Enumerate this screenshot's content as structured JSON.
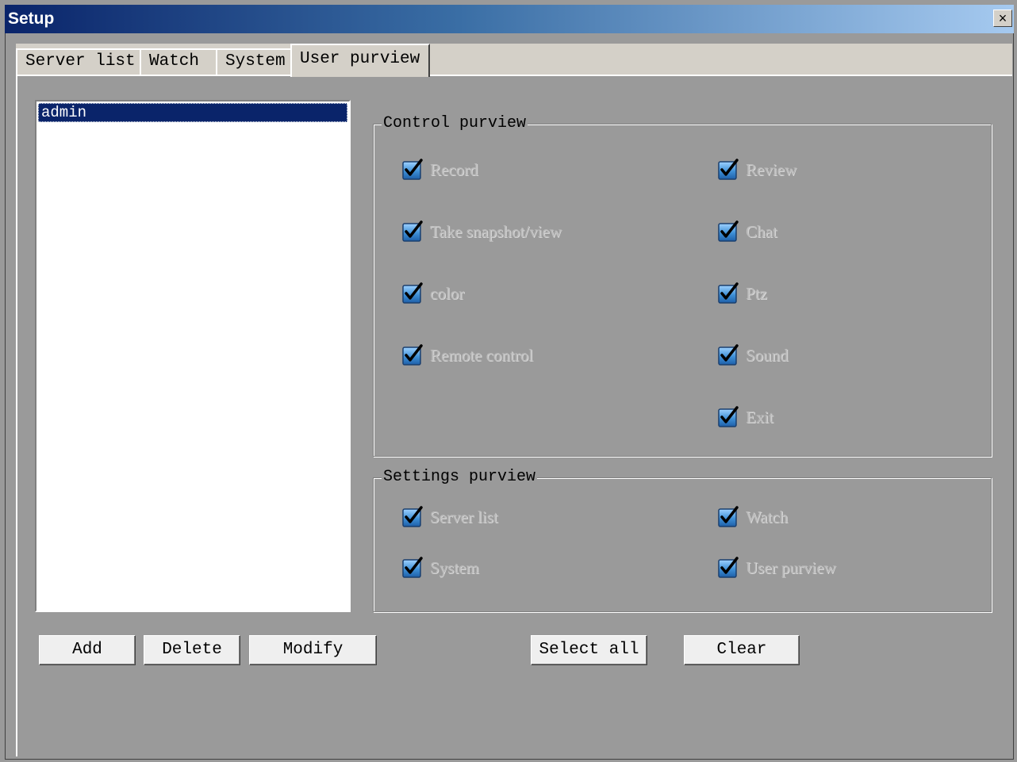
{
  "window": {
    "title": "Setup",
    "close_label": "×"
  },
  "tabs": [
    {
      "label": "Server list"
    },
    {
      "label": "Watch"
    },
    {
      "label": "System"
    },
    {
      "label": "User purview"
    }
  ],
  "active_tab": "User purview",
  "user_list": {
    "items": [
      "admin"
    ],
    "selected": "admin"
  },
  "control_purview": {
    "label": "Control purview",
    "items": [
      {
        "label": "Record",
        "checked": true
      },
      {
        "label": "Review",
        "checked": true
      },
      {
        "label": "Take snapshot/view",
        "checked": true
      },
      {
        "label": "Chat",
        "checked": true
      },
      {
        "label": "color",
        "checked": true
      },
      {
        "label": "Ptz",
        "checked": true
      },
      {
        "label": "Remote control",
        "checked": true
      },
      {
        "label": "Sound",
        "checked": true
      },
      {
        "label": "Exit",
        "checked": true
      }
    ]
  },
  "settings_purview": {
    "label": "Settings purview",
    "items": [
      {
        "label": "Server list",
        "checked": true
      },
      {
        "label": "Watch",
        "checked": true
      },
      {
        "label": "System",
        "checked": true
      },
      {
        "label": "User purview",
        "checked": true
      }
    ]
  },
  "buttons": {
    "add": "Add",
    "delete": "Delete",
    "modify": "Modify",
    "select_all": "Select all",
    "clear": "Clear"
  },
  "colors": {
    "title_start": "#0a246a",
    "title_end": "#a6caf0",
    "dialog_bg": "#9a9a9a",
    "selection": "#0a246a",
    "checkbox_fill": "#3d8fd6"
  }
}
